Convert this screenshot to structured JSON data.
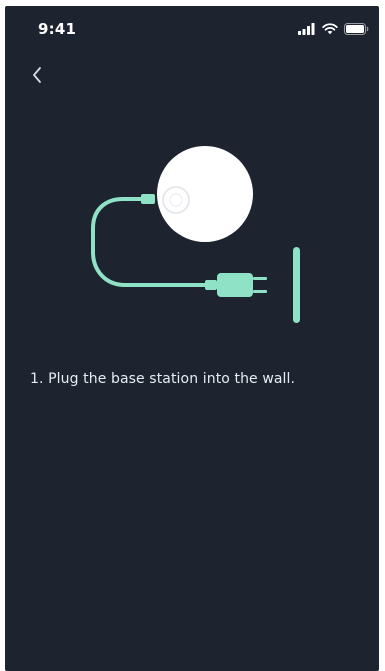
{
  "status_bar": {
    "time": "9:41",
    "signal_icon": "cellular-signal-icon",
    "wifi_icon": "wifi-icon",
    "battery_icon": "battery-icon"
  },
  "navigation": {
    "back_icon": "chevron-left-icon"
  },
  "illustration": {
    "device": "base-station",
    "device_color": "#ffffff",
    "cable_color": "#8fe2c5",
    "wall_outlet_color": "#8fe2c5"
  },
  "content": {
    "step_text": "1. Plug the base station into the wall."
  },
  "colors": {
    "background": "#1d2430",
    "text": "#e7ecf2",
    "accent": "#8fe2c5"
  }
}
